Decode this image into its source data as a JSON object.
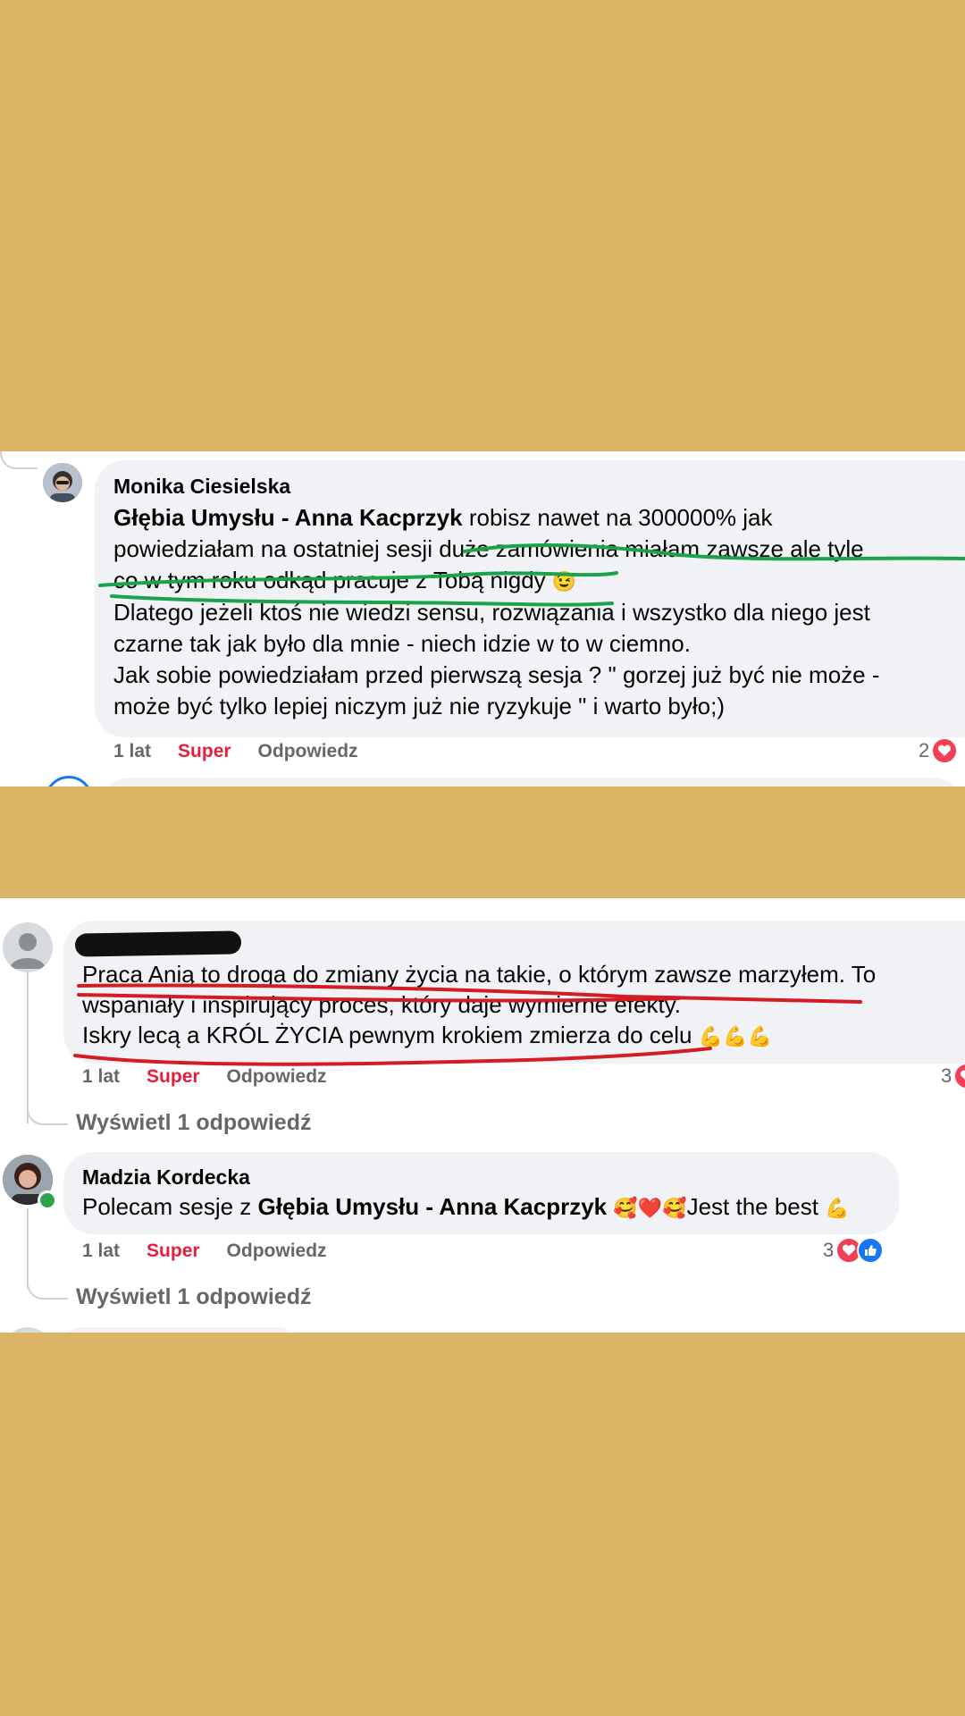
{
  "comment1": {
    "author": "Monika Ciesielska",
    "mention": "Głębia Umysłu - Anna Kacprzyk",
    "line1_rest": " robisz nawet na 300000% jak",
    "line2": "powiedziałam na ostatniej sesji duże zamówienia miałam zawsze ale tyle",
    "line3": "co w tym roku odkąd pracuje z Tobą nigdy",
    "line3_emoji": "😉",
    "line4": "Dlatego jeżeli ktoś nie wiedzi sensu, rozwiązania i wszystko dla niego jest",
    "line5": "czarne tak jak było dla mnie - niech idzie w to w ciemno.",
    "line6": "Jak sobie powiedziałam przed pierwszą sesja ? \" gorzej już być nie może -",
    "line7": "może być tylko lepiej niczym już nie ryzykuje \" i warto było;)",
    "time": "1 lat",
    "like": "Super",
    "reply": "Odpowiedz",
    "reaction_count": "2",
    "reaction_icon": "heart-icon"
  },
  "comment2": {
    "author": "",
    "line1": "Praca Anią to droga do zmiany życia na takie, o którym zawsze marzyłem. To",
    "line2": "wspaniały i inspirujący proces, który daje wymierne efekty.",
    "line3": "Iskry lecą a KRÓL ŻYCIA pewnym krokiem zmierza do celu",
    "line3_emoji": "💪💪💪",
    "time": "1 lat",
    "like": "Super",
    "reply": "Odpowiedz",
    "reaction_count": "3",
    "view_replies": "Wyświetl 1 odpowiedź"
  },
  "comment3": {
    "author": "Madzia Kordecka",
    "prefix": "Polecam sesje z ",
    "mention": "Głębia Umysłu - Anna Kacprzyk",
    "emojis": "🥰❤️🥰",
    "suffix": "Jest the best",
    "end_emoji": "💪",
    "time": "1 lat",
    "like": "Super",
    "reply": "Odpowiedz",
    "reaction_count": "3",
    "view_replies": "Wyświetl 1 odpowiedź"
  },
  "colors": {
    "background": "#dcb465",
    "super": "#e41e3f",
    "green_marker": "#1aa34a",
    "red_marker": "#d41c24",
    "like_blue": "#1877f2"
  }
}
